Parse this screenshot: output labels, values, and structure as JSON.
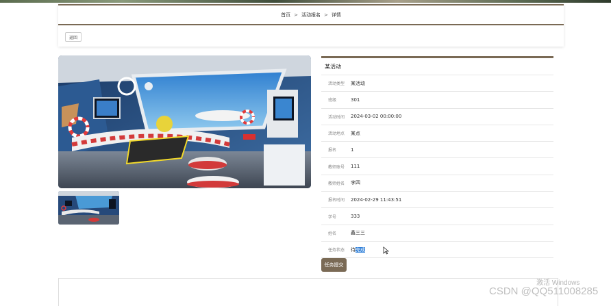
{
  "breadcrumb": {
    "home": "首页",
    "section": "活动报名",
    "current": "详情",
    "separator": ">"
  },
  "back_label": "返回",
  "activity": {
    "title": "某活动",
    "fields": [
      {
        "label": "活动类型",
        "value": "某活动"
      },
      {
        "label": "班级",
        "value": "301"
      },
      {
        "label": "活动时间",
        "value": "2024-03-02 00:00:00"
      },
      {
        "label": "活动地点",
        "value": "某点"
      },
      {
        "label": "报名",
        "value": "1"
      },
      {
        "label": "教师账号",
        "value": "111"
      },
      {
        "label": "教师姓名",
        "value": "李四"
      },
      {
        "label": "报名时间",
        "value": "2024-02-29 11:43:51"
      },
      {
        "label": "学号",
        "value": "333"
      },
      {
        "label": "姓名",
        "value": "鑫三三"
      }
    ],
    "status": {
      "label": "任务状态",
      "value_plain": "待",
      "value_selected": "完成"
    }
  },
  "submit_label": "任务提交",
  "watermarks": {
    "activate": "激活 Windows",
    "csdn": "CSDN @QQ511008285"
  },
  "colors": {
    "accent": "#7a6a55",
    "selection": "#2f7fd8"
  }
}
